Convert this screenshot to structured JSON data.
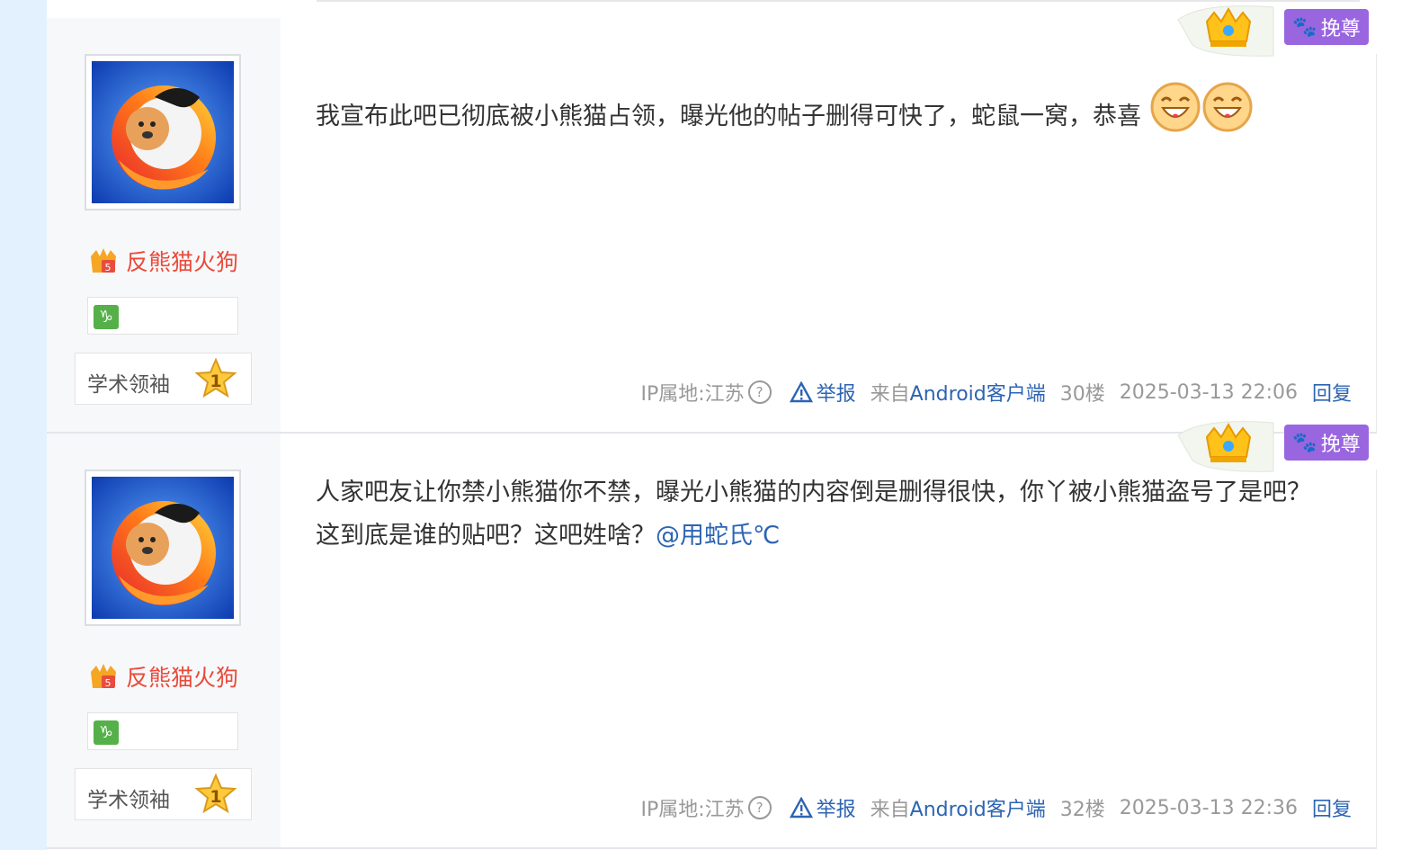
{
  "posts": [
    {
      "username": "反熊猫火狗",
      "user_title": "学术领袖",
      "level": "1",
      "zodiac_symbol": "♑",
      "corner_badge": "挽尊",
      "content": "我宣布此吧已彻底被小熊猫占领，曝光他的帖子删得可快了，蛇鼠一窝，恭喜",
      "mention": "",
      "emojis": [
        "laugh-emoji",
        "laugh-emoji"
      ],
      "ip_location": "IP属地:江苏",
      "report_label": "举报",
      "source_prefix": "来自",
      "source_client": "Android客户端",
      "floor": "30楼",
      "timestamp": "2025-03-13 22:06",
      "reply_label": "回复"
    },
    {
      "username": "反熊猫火狗",
      "user_title": "学术领袖",
      "level": "1",
      "zodiac_symbol": "♑",
      "corner_badge": "挽尊",
      "content": "人家吧友让你禁小熊猫你不禁，曝光小熊猫的内容倒是删得很快，你丫被小熊猫盗号了是吧？这到底是谁的贴吧？这吧姓啥？",
      "mention": "@用蛇氏℃",
      "emojis": [],
      "ip_location": "IP属地:江苏",
      "report_label": "举报",
      "source_prefix": "来自",
      "source_client": "Android客户端",
      "floor": "32楼",
      "timestamp": "2025-03-13 22:36",
      "reply_label": "回复"
    }
  ],
  "colors": {
    "link_blue": "#2d64b3",
    "username_red": "#ea4a3a",
    "badge_purple": "#9966e0",
    "sidebar_bg": "#f7f8fa",
    "page_left_bg": "#e3f1fe"
  }
}
